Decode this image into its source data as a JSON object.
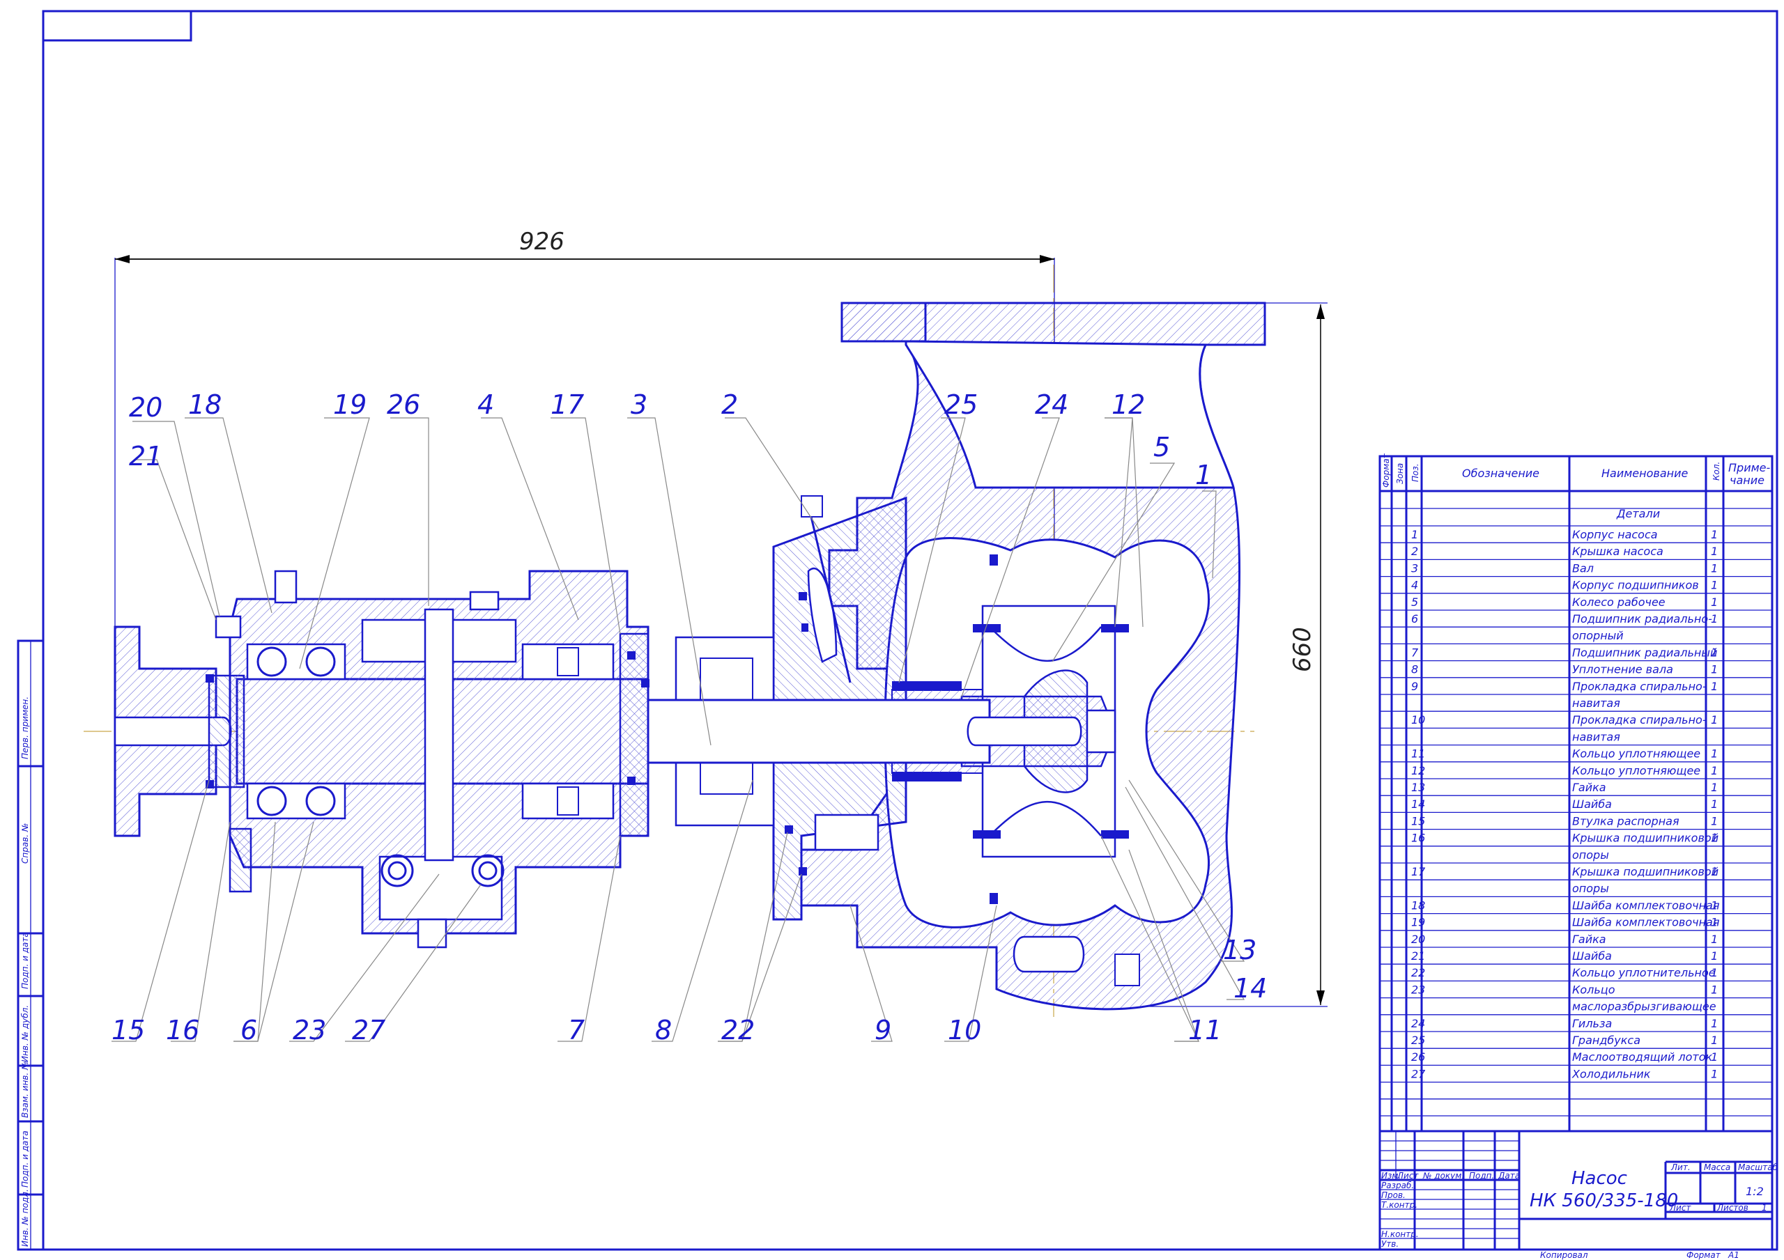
{
  "dimensions": {
    "length": "926",
    "height": "660"
  },
  "balloons": [
    "20",
    "18",
    "19",
    "26",
    "4",
    "17",
    "3",
    "2",
    "25",
    "24",
    "12",
    "5",
    "1",
    "21",
    "13",
    "14",
    "15",
    "16",
    "6",
    "23",
    "27",
    "7",
    "8",
    "22",
    "9",
    "10",
    "11"
  ],
  "table": {
    "headers": {
      "format": "Формат",
      "zone": "Зона",
      "pos": "Поз.",
      "designation": "Обозначение",
      "name": "Наименование",
      "qty": "Кол.",
      "note_1": "Приме-",
      "note_2": "чание"
    },
    "section": "Детали",
    "rows": [
      {
        "pos": "1",
        "name": "Корпус насоса",
        "qty": "1"
      },
      {
        "pos": "2",
        "name": "Крышка насоса",
        "qty": "1"
      },
      {
        "pos": "3",
        "name": "Вал",
        "qty": "1"
      },
      {
        "pos": "4",
        "name": "Корпус подшипников",
        "qty": "1"
      },
      {
        "pos": "5",
        "name": "Колесо рабочее",
        "qty": "1"
      },
      {
        "pos": "6",
        "name": "Подшипник радиально-",
        "name2": "опорный",
        "qty": "1"
      },
      {
        "pos": "7",
        "name": "Подшипник радиальный",
        "qty": "1"
      },
      {
        "pos": "8",
        "name": "Уплотнение вала",
        "qty": "1"
      },
      {
        "pos": "9",
        "name": "Прокладка спирально-",
        "name2": "навитая",
        "qty": "1"
      },
      {
        "pos": "10",
        "name": "Прокладка спирально-",
        "name2": "навитая",
        "qty": "1"
      },
      {
        "pos": "11",
        "name": "Кольцо уплотняющее",
        "qty": "1"
      },
      {
        "pos": "12",
        "name": "Кольцо уплотняющее",
        "qty": "1"
      },
      {
        "pos": "13",
        "name": "Гайка",
        "qty": "1"
      },
      {
        "pos": "14",
        "name": "Шайба",
        "qty": "1"
      },
      {
        "pos": "15",
        "name": "Втулка распорная",
        "qty": "1"
      },
      {
        "pos": "16",
        "name": "Крышка подшипниковой",
        "name2": "опоры",
        "qty": "1"
      },
      {
        "pos": "17",
        "name": "Крышка подшипниковой",
        "name2": "опоры",
        "qty": "1"
      },
      {
        "pos": "18",
        "name": "Шайба комплектовочная",
        "qty": "1"
      },
      {
        "pos": "19",
        "name": "Шайба комплектовочная",
        "qty": "1"
      },
      {
        "pos": "20",
        "name": "Гайка",
        "qty": "1"
      },
      {
        "pos": "21",
        "name": "Шайба",
        "qty": "1"
      },
      {
        "pos": "22",
        "name": "Кольцо уплотнительное",
        "qty": "1"
      },
      {
        "pos": "23",
        "name": "Кольцо",
        "name2": "маслоразбрызгивающее",
        "qty": "1"
      },
      {
        "pos": "24",
        "name": "Гильза",
        "qty": "1"
      },
      {
        "pos": "25",
        "name": "Грандбукса",
        "qty": "1"
      },
      {
        "pos": "26",
        "name": "Маслоотводящий лоток",
        "qty": "1"
      },
      {
        "pos": "27",
        "name": "Холодильник",
        "qty": "1"
      }
    ]
  },
  "title_block": {
    "title_1": "Насос",
    "title_2": "НК 560/335-180",
    "scale": "1:2",
    "lit": "Лит.",
    "mass": "Масса",
    "scale_label": "Масштаб",
    "sheet": "Лист",
    "sheets": "Листов",
    "sheets_value": "1",
    "col_izm": "Изм.",
    "col_list": "Лист",
    "col_doc": "№ докум.",
    "col_sign": "Подп.",
    "col_date": "Дата",
    "razrab": "Разраб.",
    "prov": "Пров.",
    "tkontr": "Т.контр.",
    "nkontr": "Н.контр.",
    "utv": "Утв.",
    "copied": "Копировал",
    "format": "Формат",
    "format_value": "A1"
  },
  "side_stamps": [
    "Перв. примен.",
    "Справ. №",
    "Подп. и дата",
    "Инв. № дубл.",
    "Взам. инв. №",
    "Подп. и дата",
    "Инв. № подл."
  ]
}
